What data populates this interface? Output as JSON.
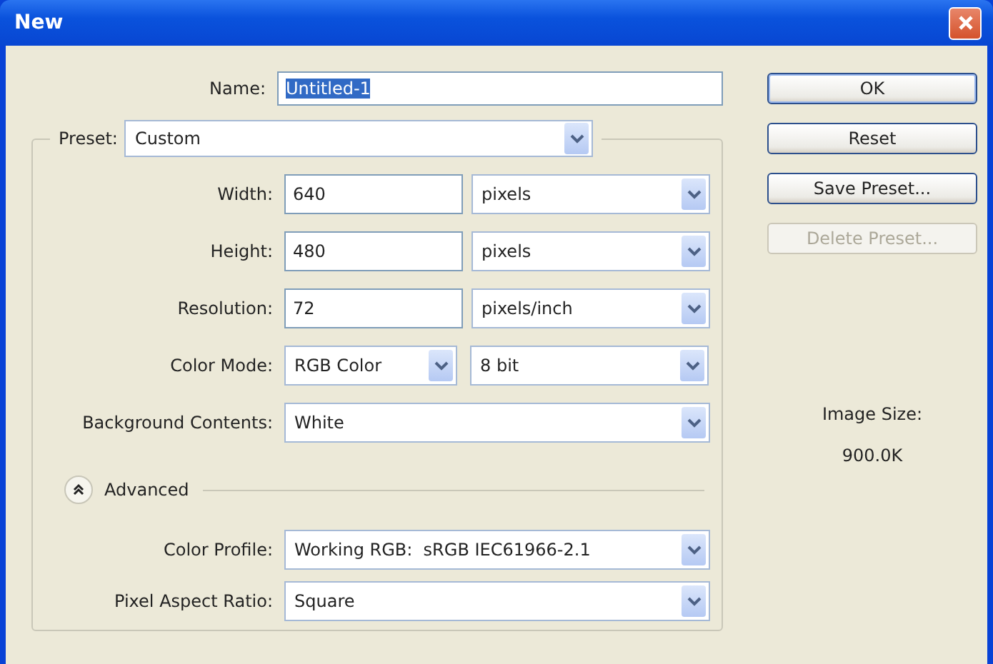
{
  "window": {
    "title": "New"
  },
  "name": {
    "label": "Name:",
    "value": "Untitled-1",
    "text_selected": true
  },
  "preset": {
    "label": "Preset:",
    "value": "Custom"
  },
  "fields": [
    {
      "kind": "number_unit",
      "label": "Width:",
      "value": "640",
      "unit": "pixels"
    },
    {
      "kind": "number_unit",
      "label": "Height:",
      "value": "480",
      "unit": "pixels"
    },
    {
      "kind": "number_unit",
      "label": "Resolution:",
      "value": "72",
      "unit": "pixels/inch"
    },
    {
      "kind": "two_dropdowns",
      "label": "Color Mode:",
      "value": "RGB Color",
      "unit": "8 bit"
    },
    {
      "kind": "dropdown",
      "label": "Background Contents:",
      "value": "White"
    }
  ],
  "advanced": {
    "label": "Advanced",
    "expanded": true
  },
  "advanced_fields": [
    {
      "kind": "dropdown",
      "label": "Color Profile:",
      "value": "Working RGB:  sRGB IEC61966-2.1"
    },
    {
      "kind": "dropdown",
      "label": "Pixel Aspect Ratio:",
      "value": "Square"
    }
  ],
  "buttons": [
    {
      "label": "OK",
      "default": true,
      "disabled": false
    },
    {
      "label": "Reset",
      "default": false,
      "disabled": false
    },
    {
      "label": "Save Preset...",
      "default": false,
      "disabled": false
    },
    {
      "label": "Delete Preset...",
      "default": false,
      "disabled": true
    }
  ],
  "image_size": {
    "label": "Image Size:",
    "value": "900.0K"
  }
}
